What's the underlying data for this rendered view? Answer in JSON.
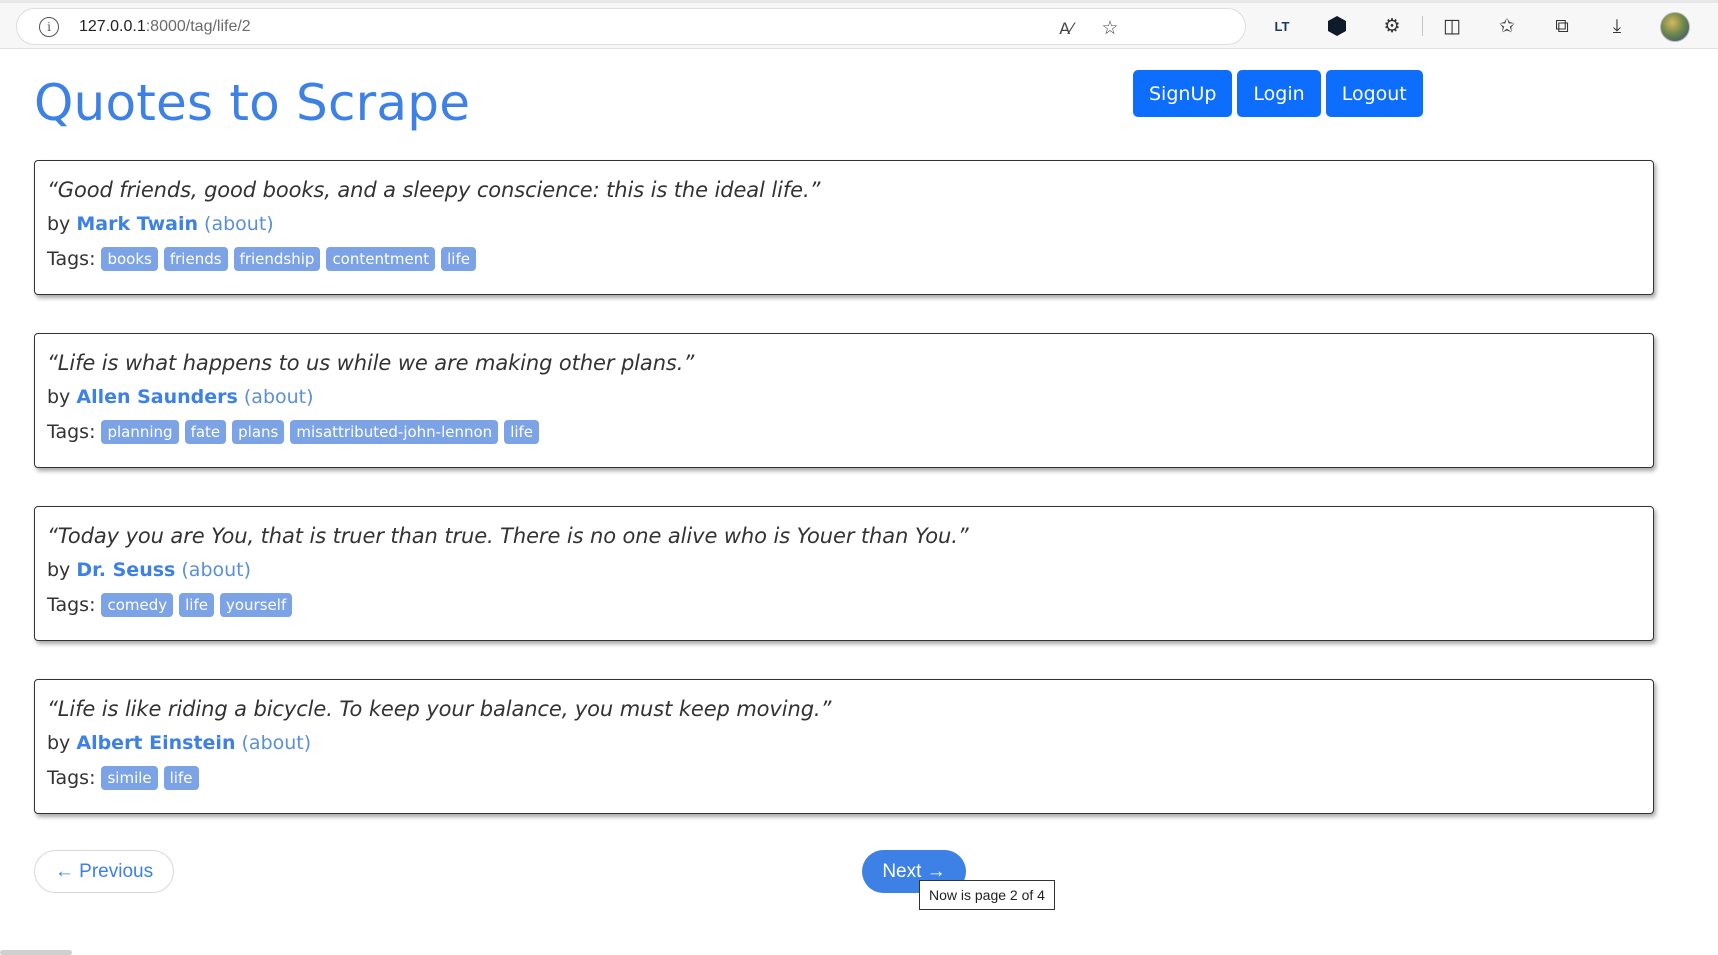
{
  "browser": {
    "url_host": "127.0.0.1",
    "url_rest": ":8000/tag/life/2",
    "icons": [
      "info-icon",
      "read-aloud-icon",
      "favorite-star-icon",
      "languagetool-icon",
      "extension-hex-icon",
      "extensions-puzzle-icon",
      "split-screen-icon",
      "favorites-icon",
      "collections-icon",
      "download-icon",
      "profile-avatar"
    ]
  },
  "site": {
    "title": "Quotes to Scrape",
    "buttons": {
      "signup": "SignUp",
      "login": "Login",
      "logout": "Logout"
    }
  },
  "quotes": [
    {
      "text": "“Good friends, good books, and a sleepy conscience: this is the ideal life.”",
      "by_label": "by",
      "author": "Mark Twain",
      "about": "(about)",
      "tags_label": "Tags:",
      "tags": [
        "books",
        "friends",
        "friendship",
        "contentment",
        "life"
      ]
    },
    {
      "text": "“Life is what happens to us while we are making other plans.”",
      "by_label": "by",
      "author": "Allen Saunders",
      "about": "(about)",
      "tags_label": "Tags:",
      "tags": [
        "planning",
        "fate",
        "plans",
        "misattributed-john-lennon",
        "life"
      ]
    },
    {
      "text": "“Today you are You, that is truer than true. There is no one alive who is Youer than You.”",
      "by_label": "by",
      "author": "Dr. Seuss",
      "about": "(about)",
      "tags_label": "Tags:",
      "tags": [
        "comedy",
        "life",
        "yourself"
      ]
    },
    {
      "text": "“Life is like riding a bicycle. To keep your balance, you must keep moving.”",
      "by_label": "by",
      "author": "Albert Einstein",
      "about": "(about)",
      "tags_label": "Tags:",
      "tags": [
        "simile",
        "life"
      ]
    }
  ],
  "pager": {
    "previous": "← Previous",
    "next": "Next →",
    "tooltip": "Now is page 2 of 4"
  },
  "colors": {
    "brand": "#3d81e6",
    "button": "#0d6efd",
    "tag": "#7ca3e6"
  }
}
